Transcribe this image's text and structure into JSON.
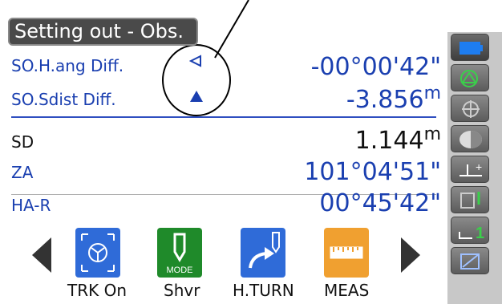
{
  "title": "Setting out - Obs.",
  "so_rows": [
    {
      "label": "SO.H.ang Diff.",
      "value": "-00°00'42\"",
      "unit": ""
    },
    {
      "label": "SO.Sdist Diff.",
      "value": "-3.856",
      "unit": "m"
    }
  ],
  "meas_rows": [
    {
      "label": "SD",
      "value": "1.144",
      "unit": "m"
    },
    {
      "label": "ZA",
      "value": "101°04'51\"",
      "unit": ""
    },
    {
      "label": "HA-R",
      "value": "00°45'42\"",
      "unit": ""
    }
  ],
  "softkeys": [
    {
      "label": "TRK On",
      "icon": "tracking-icon",
      "color": "#2f6bd8"
    },
    {
      "label": "Shvr",
      "icon": "mode-icon",
      "icon_text": "MODE",
      "color": "#1f8a2a"
    },
    {
      "label": "H.TURN",
      "icon": "h-turn-icon",
      "color": "#2f6bd8"
    },
    {
      "label": "MEAS",
      "icon": "ruler-icon",
      "color": "#f0a030"
    }
  ],
  "side_rail": [
    {
      "icon": "battery-icon"
    },
    {
      "icon": "prism-target-icon"
    },
    {
      "icon": "crosshair-icon"
    },
    {
      "icon": "half-circle-icon"
    },
    {
      "icon": "height-plus-icon"
    },
    {
      "icon": "display-target-icon"
    },
    {
      "icon": "mode-1-icon",
      "text": "1"
    },
    {
      "icon": "edit-icon"
    }
  ],
  "colors": {
    "accent_blue": "#1a3fb0",
    "title_bg": "#4a4a4a"
  }
}
